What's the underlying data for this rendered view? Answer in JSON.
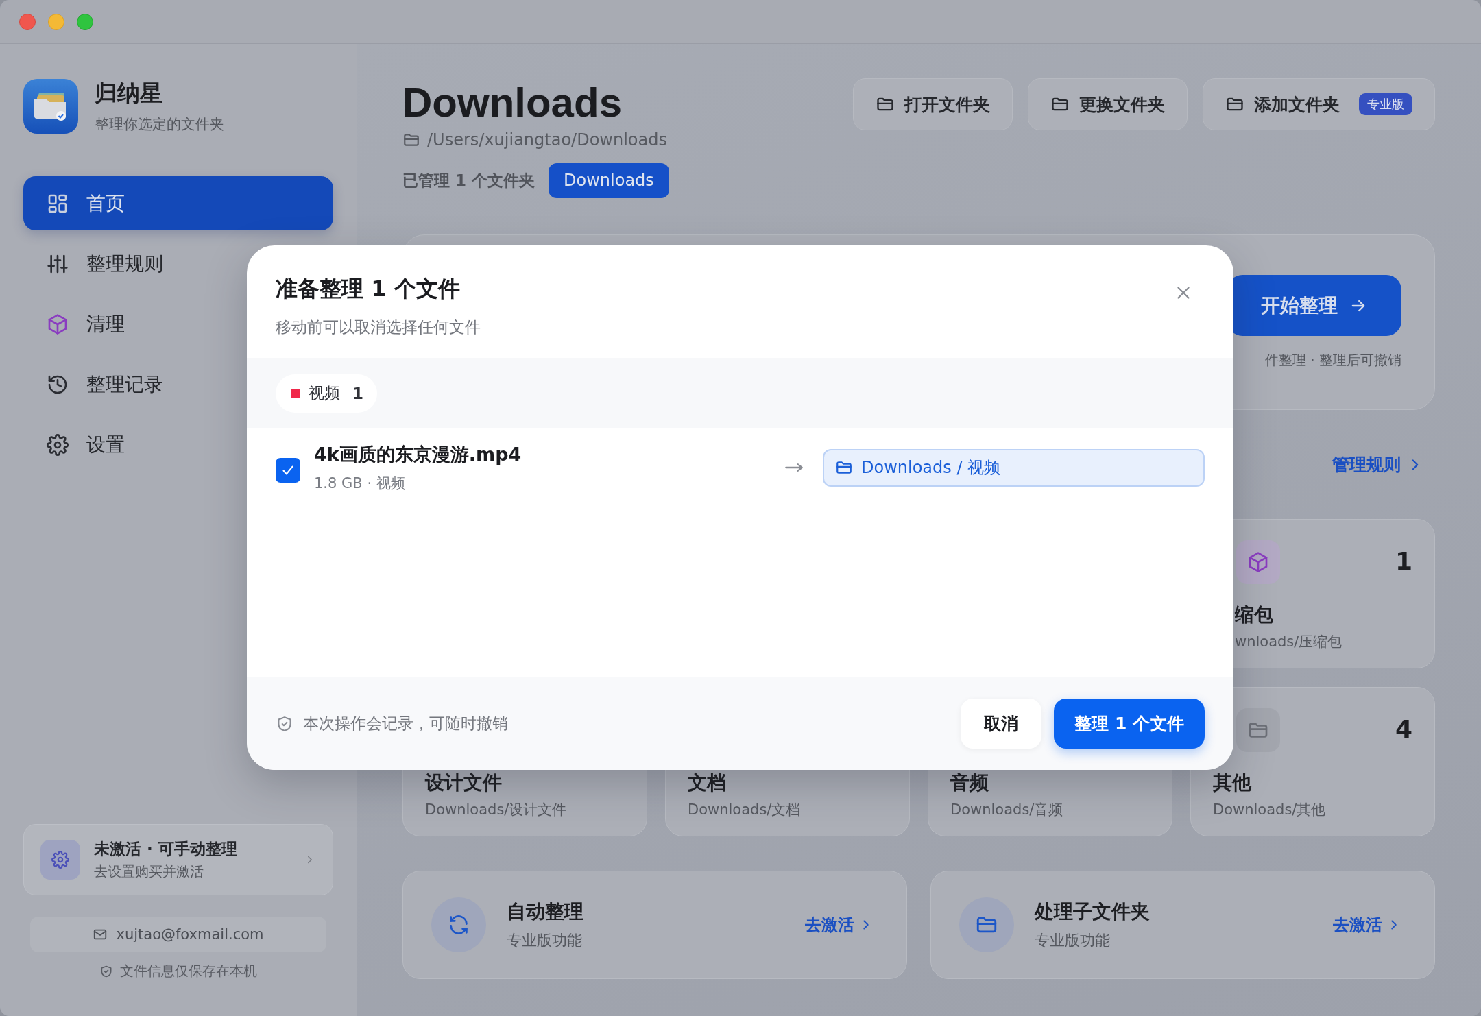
{
  "app": {
    "name": "归纳星",
    "tagline": "整理你选定的文件夹"
  },
  "nav": [
    {
      "label": "首页",
      "selected": true
    },
    {
      "label": "整理规则",
      "selected": false
    },
    {
      "label": "清理",
      "selected": false
    },
    {
      "label": "整理记录",
      "selected": false
    },
    {
      "label": "设置",
      "selected": false
    }
  ],
  "activation": {
    "title": "未激活 · 可手动整理",
    "subtitle": "去设置购买并激活"
  },
  "account": {
    "email": "xujtao@foxmail.com",
    "privacy_note": "文件信息仅保存在本机"
  },
  "header": {
    "title": "Downloads",
    "path": "/Users/xujiangtao/Downloads",
    "managed_label": "已管理 1 个文件夹",
    "folders": [
      {
        "label": "Downloads",
        "selected": true
      }
    ]
  },
  "toolbar": [
    {
      "label": "打开文件夹"
    },
    {
      "label": "更换文件夹"
    },
    {
      "label": "添加文件夹",
      "badge": "专业版"
    }
  ],
  "start_card": {
    "button": "开始整理",
    "note": "件整理 · 整理后可撤销"
  },
  "rules_link": "管理规则",
  "categories": [
    {
      "title": "缩包",
      "path": "wnloads/压缩包",
      "count": "1",
      "kind": "archive"
    },
    {
      "title": "设计文件",
      "path": "Downloads/设计文件"
    },
    {
      "title": "文档",
      "path": "Downloads/文档"
    },
    {
      "title": "音频",
      "path": "Downloads/音频"
    },
    {
      "title": "其他",
      "path": "Downloads/其他",
      "count": "4",
      "kind": "other"
    }
  ],
  "pro_features": [
    {
      "title": "自动整理",
      "subtitle": "专业版功能",
      "link": "去激活"
    },
    {
      "title": "处理子文件夹",
      "subtitle": "专业版功能",
      "link": "去激活"
    }
  ],
  "modal": {
    "title": "准备整理 1 个文件",
    "subtitle": "移动前可以取消选择任何文件",
    "groups": [
      {
        "label": "视频",
        "count": "1",
        "color": "#f0284a"
      }
    ],
    "files": [
      {
        "name": "4k画质的东京漫游.mp4",
        "meta": "1.8 GB · 视频",
        "checked": true,
        "destination": "Downloads / 视频"
      }
    ],
    "note": "本次操作会记录，可随时撤销",
    "buttons": [
      {
        "label": "取消",
        "kind": "secondary"
      },
      {
        "label": "整理 1 个文件",
        "kind": "primary"
      }
    ]
  }
}
